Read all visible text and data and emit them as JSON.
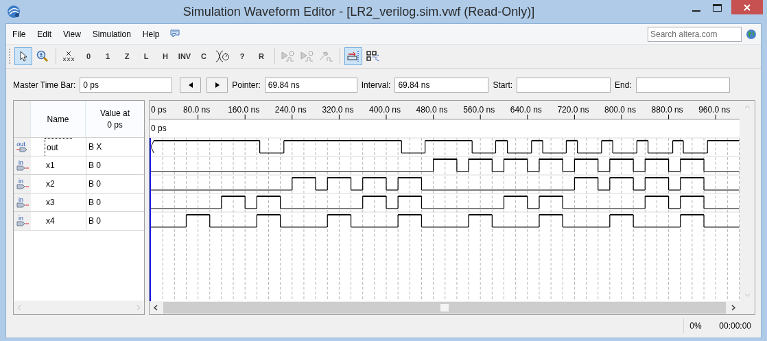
{
  "window": {
    "title": "Simulation Waveform Editor - [LR2_verilog.sim.vwf (Read-Only)]"
  },
  "menu": [
    "File",
    "Edit",
    "View",
    "Simulation",
    "Help"
  ],
  "search": {
    "placeholder": "Search altera.com"
  },
  "toolbar": [
    {
      "kind": "pointer",
      "selected": true
    },
    {
      "kind": "zoom",
      "selected": false
    },
    {
      "kind": "separator"
    },
    {
      "kind": "unknown",
      "selected": false
    },
    {
      "kind": "letter",
      "label": "0",
      "selected": false
    },
    {
      "kind": "letter",
      "label": "1",
      "selected": false
    },
    {
      "kind": "letter",
      "label": "Z",
      "selected": false
    },
    {
      "kind": "letter",
      "label": "L",
      "selected": false
    },
    {
      "kind": "letter",
      "label": "H",
      "selected": false
    },
    {
      "kind": "letter",
      "label": "INV",
      "selected": false
    },
    {
      "kind": "letter",
      "label": "C",
      "selected": false
    },
    {
      "kind": "clock",
      "selected": false
    },
    {
      "kind": "letter",
      "label": "?",
      "selected": false
    },
    {
      "kind": "letter",
      "label": "R",
      "selected": false
    },
    {
      "kind": "separator"
    },
    {
      "kind": "simulate",
      "disabled": true
    },
    {
      "kind": "simulate",
      "disabled": true
    },
    {
      "kind": "hammer",
      "disabled": true
    },
    {
      "kind": "separator"
    },
    {
      "kind": "snap",
      "selected": true
    },
    {
      "kind": "grid",
      "selected": false
    }
  ],
  "time_bar": {
    "master_label": "Master Time Bar:",
    "master_value": "0 ps",
    "pointer_label": "Pointer:",
    "pointer_value": "69.84 ns",
    "interval_label": "Interval:",
    "interval_value": "69.84 ns",
    "start_label": "Start:",
    "end_label": "End:"
  },
  "table": {
    "columns": [
      "Name",
      "Value at\n0 ps"
    ],
    "signals": [
      {
        "kind": "out",
        "port_label": "out",
        "name": "out",
        "value": "B X",
        "focused": true
      },
      {
        "kind": "in",
        "port_label": "in",
        "name": "x1",
        "value": "B 0",
        "focused": false
      },
      {
        "kind": "in",
        "port_label": "in",
        "name": "x2",
        "value": "B 0",
        "focused": false
      },
      {
        "kind": "in",
        "port_label": "in",
        "name": "x3",
        "value": "B 0",
        "focused": false
      },
      {
        "kind": "in",
        "port_label": "in",
        "name": "x4",
        "value": "B 0",
        "focused": false
      }
    ]
  },
  "ruler": {
    "ticks": [
      "0 ps",
      "80.0 ns",
      "160.0 ns",
      "240.0 ns",
      "320.0 ns",
      "400.0 ns",
      "480.0 ns",
      "560.0 ns",
      "640.0 ns",
      "720.0 ns",
      "800.0 ns",
      "880.0 ns",
      "960.0 ns"
    ],
    "cursor_label": "0 ps"
  },
  "status_bar": {
    "progress": "0%",
    "elapsed": "00:00:00"
  }
}
